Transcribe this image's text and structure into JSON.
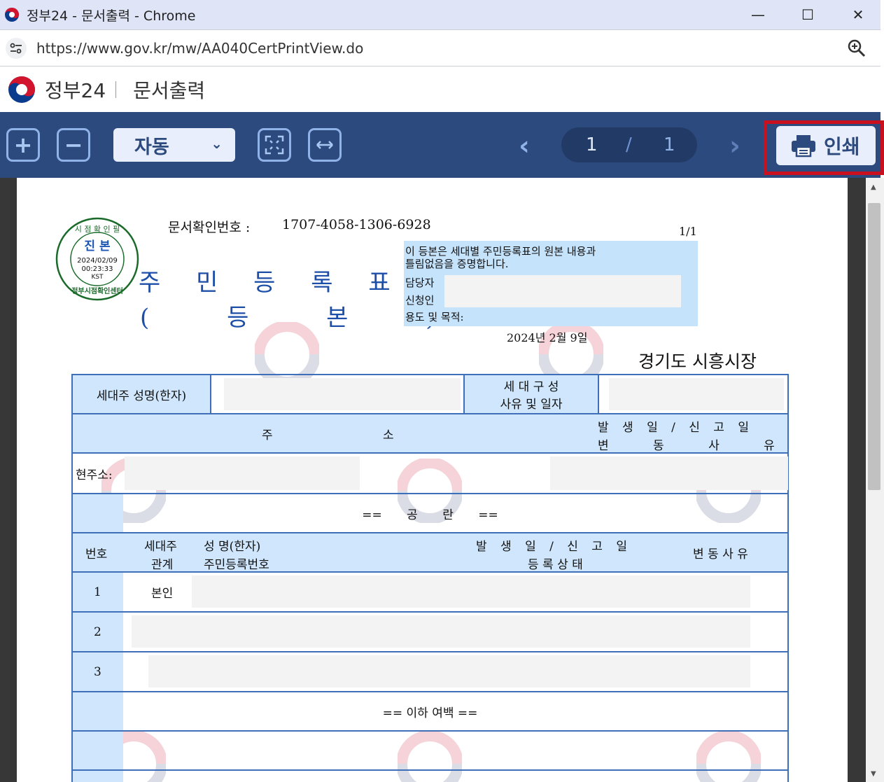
{
  "window": {
    "title": "정부24 - 문서출력 - Chrome",
    "minimize": "—",
    "maximize": "☐",
    "close": "✕"
  },
  "address_bar": {
    "url": "https://www.gov.kr/mw/AA040CertPrintView.do",
    "site_info_icon": "tune-icon",
    "zoom_icon": "magnifier-icon"
  },
  "header": {
    "brand": "정부24",
    "title": "문서출력"
  },
  "toolbar": {
    "zoom_in": "+",
    "zoom_out": "−",
    "zoom_level": "자동",
    "page_current": "1",
    "page_sep": "/",
    "page_total": "1",
    "prev": "‹",
    "next": "›",
    "print_label": "인쇄",
    "accent": "#2d4a7e",
    "highlight": "#c8101f"
  },
  "document": {
    "confirm_number_label": "문서확인번호 :",
    "confirm_number": "1707-4058-1306-6928",
    "page_ratio": "1/1",
    "stamp": {
      "top": "시 점 확 인 필",
      "center": "진 본",
      "date": "2024/02/09",
      "time": "00:23:33",
      "tz": "KST",
      "bottom": "정부시점확인센터"
    },
    "title_line1": "주 민 등 록 표",
    "title_line2": "( 등 본 )",
    "cert_text_1": "이 등본은 세대별 주민등록표의 원본 내용과",
    "cert_text_2": "틀림없음을 증명합니다.",
    "cert_handler": "담당자",
    "cert_applicant": "신청인",
    "cert_purpose": "용도 및 목적:",
    "issue_date": "2024년 2월 9일",
    "issuer": "경기도 시흥시장",
    "head_name_label": "세대주 성명(한자)",
    "composition_label_1": "세 대 구 성",
    "composition_label_2": "사유 및 일자",
    "address_label_a": "주",
    "address_label_b": "소",
    "dates_label_1": "발 생 일 / 신 고 일",
    "dates_label_2": "변 동 사 유",
    "current_address": "현주소:",
    "blank_mark": "== 공 란 ==",
    "col_no": "번호",
    "col_relation_1": "세대주",
    "col_relation_2": "관계",
    "col_name_1": "성 명(한자)",
    "col_name_2": "주민등록번호",
    "col_dates_1": "발 생 일 / 신 고 일",
    "col_dates_2": "등 록 상 태",
    "col_reason": "변 동 사 유",
    "rows": [
      {
        "no": "1",
        "relation": "본인"
      },
      {
        "no": "2",
        "relation": ""
      },
      {
        "no": "3",
        "relation": ""
      }
    ],
    "end_mark": "== 이하 여백 =="
  }
}
